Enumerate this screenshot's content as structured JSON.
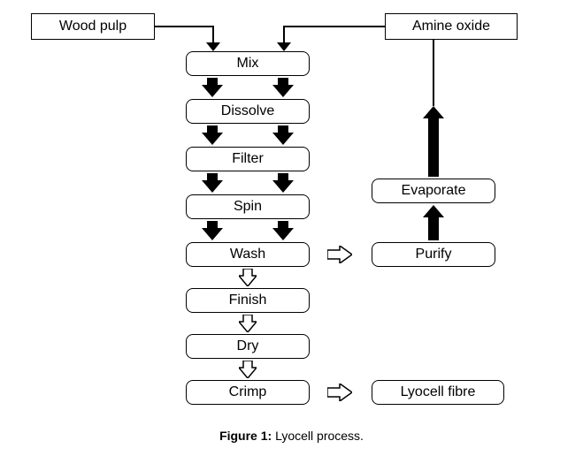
{
  "inputs": {
    "left": "Wood pulp",
    "right": "Amine oxide"
  },
  "main_steps": {
    "mix": "Mix",
    "dissolve": "Dissolve",
    "filter": "Filter",
    "spin": "Spin",
    "wash": "Wash",
    "finish": "Finish",
    "dry": "Dry",
    "crimp": "Crimp"
  },
  "side_steps": {
    "purify": "Purify",
    "evaporate": "Evaporate",
    "output": "Lyocell fibre"
  },
  "caption": {
    "label": "Figure 1:",
    "text": " Lyocell process."
  },
  "chart_data": {
    "type": "flowchart",
    "title": "Lyocell process",
    "nodes": [
      {
        "id": "wood_pulp",
        "label": "Wood pulp",
        "kind": "input"
      },
      {
        "id": "amine_oxide",
        "label": "Amine oxide",
        "kind": "input"
      },
      {
        "id": "mix",
        "label": "Mix",
        "kind": "process"
      },
      {
        "id": "dissolve",
        "label": "Dissolve",
        "kind": "process"
      },
      {
        "id": "filter",
        "label": "Filter",
        "kind": "process"
      },
      {
        "id": "spin",
        "label": "Spin",
        "kind": "process"
      },
      {
        "id": "wash",
        "label": "Wash",
        "kind": "process"
      },
      {
        "id": "finish",
        "label": "Finish",
        "kind": "process"
      },
      {
        "id": "dry",
        "label": "Dry",
        "kind": "process"
      },
      {
        "id": "crimp",
        "label": "Crimp",
        "kind": "process"
      },
      {
        "id": "purify",
        "label": "Purify",
        "kind": "process"
      },
      {
        "id": "evaporate",
        "label": "Evaporate",
        "kind": "process"
      },
      {
        "id": "lyocell_fibre",
        "label": "Lyocell fibre",
        "kind": "output"
      }
    ],
    "edges": [
      {
        "from": "wood_pulp",
        "to": "mix",
        "style": "line"
      },
      {
        "from": "amine_oxide",
        "to": "mix",
        "style": "line"
      },
      {
        "from": "mix",
        "to": "dissolve",
        "style": "solid"
      },
      {
        "from": "dissolve",
        "to": "filter",
        "style": "solid"
      },
      {
        "from": "filter",
        "to": "spin",
        "style": "solid"
      },
      {
        "from": "spin",
        "to": "wash",
        "style": "solid"
      },
      {
        "from": "wash",
        "to": "finish",
        "style": "hollow"
      },
      {
        "from": "finish",
        "to": "dry",
        "style": "hollow"
      },
      {
        "from": "dry",
        "to": "crimp",
        "style": "hollow"
      },
      {
        "from": "wash",
        "to": "purify",
        "style": "hollow"
      },
      {
        "from": "purify",
        "to": "evaporate",
        "style": "solid"
      },
      {
        "from": "evaporate",
        "to": "amine_oxide",
        "style": "solid"
      },
      {
        "from": "crimp",
        "to": "lyocell_fibre",
        "style": "hollow"
      }
    ]
  }
}
